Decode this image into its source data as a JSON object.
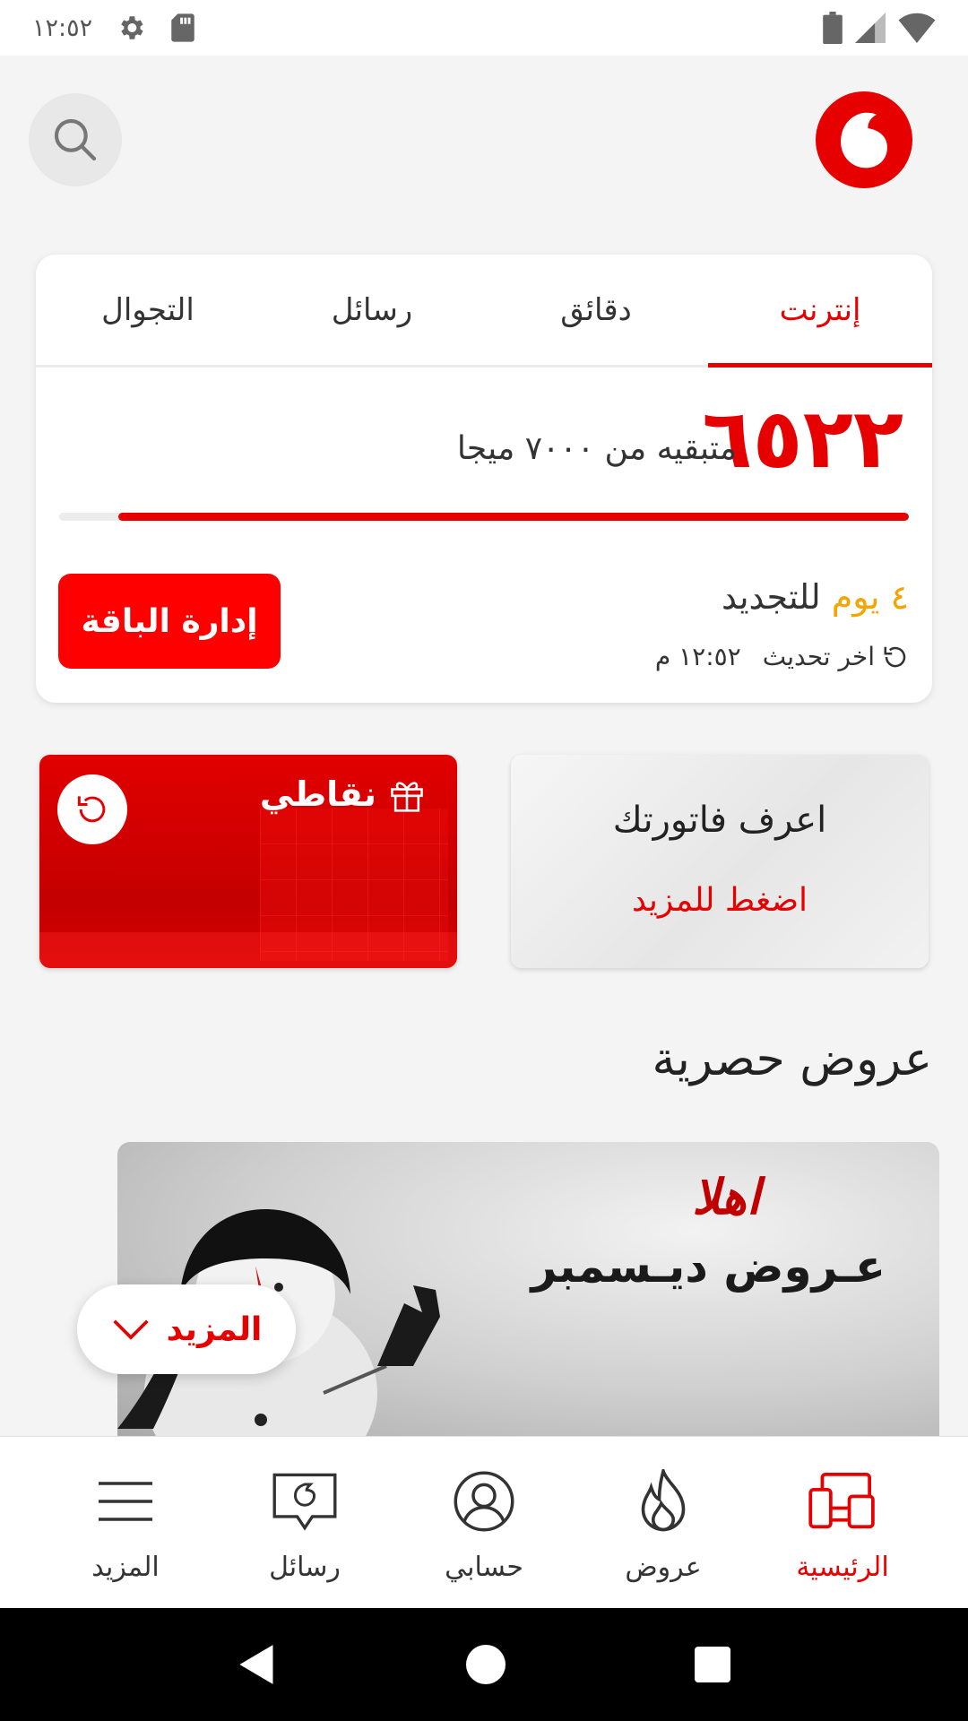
{
  "status_bar": {
    "time": "١٢:٥٢"
  },
  "header": {
    "logo": "vodafone-logo"
  },
  "usage": {
    "tabs": [
      {
        "label": "إنترنت",
        "active": true
      },
      {
        "label": "دقائق",
        "active": false
      },
      {
        "label": "رسائل",
        "active": false
      },
      {
        "label": "التجوال",
        "active": false
      }
    ],
    "remaining": "٦٥٢٢",
    "remaining_text": "متبقيه من ٧٠٠٠ ميجا",
    "progress_fraction": 0.93,
    "renew_days": "٤ يوم",
    "renew_label": "للتجديد",
    "last_update": "اخر تحديث",
    "last_update_time": "١٢:٥٢ م",
    "manage_label": "إدارة الباقة"
  },
  "cards": {
    "points_title": "نقاطي",
    "bill_title": "اعرف فاتورتك",
    "bill_link": "اضغط للمزيد"
  },
  "offers": {
    "section_title": "عروض حصرية",
    "banner_hello": "اهلا",
    "banner_title": "عـروض ديـسمبر"
  },
  "more_pill": {
    "label": "المزيد"
  },
  "bottom_nav": [
    {
      "label": "الرئيسية",
      "icon": "home-devices-icon",
      "active": true
    },
    {
      "label": "عروض",
      "icon": "flame-icon",
      "active": false
    },
    {
      "label": "حسابي",
      "icon": "user-icon",
      "active": false
    },
    {
      "label": "رسائل",
      "icon": "message-icon",
      "active": false
    },
    {
      "label": "المزيد",
      "icon": "menu-icon",
      "active": false
    }
  ],
  "colors": {
    "brand_red": "#e60000",
    "accent_orange": "#f5a400"
  }
}
